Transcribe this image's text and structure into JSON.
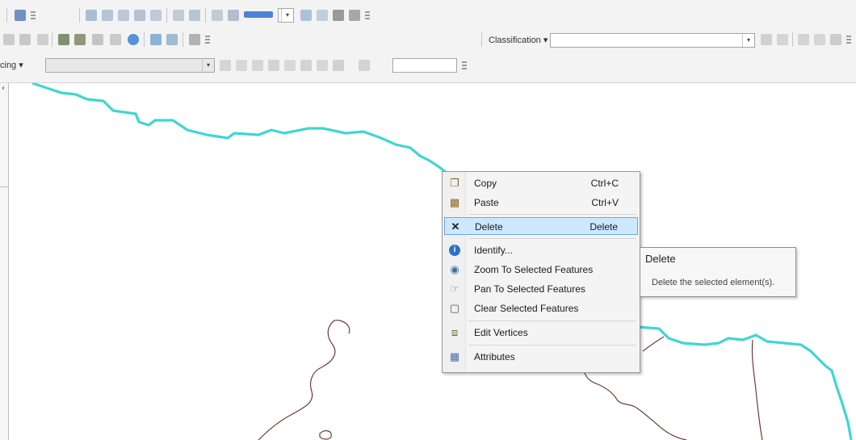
{
  "toolbar": {
    "classification_label": "Classification ▾",
    "classification_value": "",
    "tracing_label": "cing ▾",
    "tracing_value": "",
    "small_combo_value": "",
    "colors": {
      "swatch": "#2f6fd0",
      "bg": "#f3f3f3"
    }
  },
  "map": {
    "colors": {
      "boundary": "#40d6d2",
      "outline": "#6b3a3a"
    }
  },
  "context_menu": {
    "items": [
      {
        "icon": "copy-icon",
        "label": "Copy",
        "shortcut": "Ctrl+C"
      },
      {
        "icon": "paste-icon",
        "label": "Paste",
        "shortcut": "Ctrl+V"
      },
      {
        "icon": "delete-icon",
        "label": "Delete",
        "shortcut": "Delete",
        "selected": true
      },
      {
        "icon": "identify-icon",
        "label": "Identify...",
        "shortcut": ""
      },
      {
        "icon": "zoom-to-selected-icon",
        "label": "Zoom To Selected Features",
        "shortcut": ""
      },
      {
        "icon": "pan-to-selected-icon",
        "label": "Pan To Selected Features",
        "shortcut": ""
      },
      {
        "icon": "clear-selected-icon",
        "label": "Clear Selected Features",
        "shortcut": ""
      },
      {
        "icon": "edit-vertices-icon",
        "label": "Edit Vertices",
        "shortcut": ""
      },
      {
        "icon": "attributes-icon",
        "label": "Attributes",
        "shortcut": ""
      }
    ]
  },
  "tooltip": {
    "title": "Delete",
    "description": "Delete the selected element(s)."
  }
}
